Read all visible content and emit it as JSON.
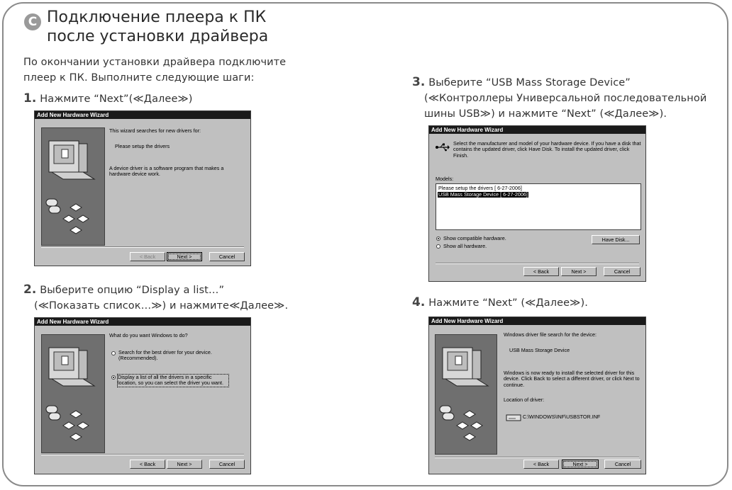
{
  "header": {
    "icon_letter": "C",
    "title_line1": "Подключение плеера к ПК",
    "title_line2": "после установки драйвера"
  },
  "intro": {
    "line1": "По окончании установки драйвера подключите",
    "line2": "плеер к ПК. Выполните следующие шаги:"
  },
  "steps": [
    {
      "number": "1.",
      "line1": "Нажмите “Next”(≪Далее≫)"
    },
    {
      "number": "2.",
      "line1": "Выберите опцию “Display a list…”",
      "line2": "(≪Показать список…≫) и нажмите≪Далее≫."
    },
    {
      "number": "3.",
      "line1": "Выберите “USB Mass Storage Device”",
      "line2": "(≪Контроллеры Универсальной последовательной",
      "line3": "шины USB≫) и нажмите “Next” (≪Далее≫)."
    },
    {
      "number": "4.",
      "line1": "Нажмите “Next” (≪Далее≫)."
    }
  ],
  "dialogs": {
    "d1": {
      "title": "Add New Hardware Wizard",
      "text1": "This wizard searches for new drivers for:",
      "text2": "Please setup the drivers",
      "text3": "A device driver is a software program that makes a hardware device work.",
      "back": "< Back",
      "next": "Next >",
      "cancel": "Cancel"
    },
    "d2": {
      "title": "Add New Hardware Wizard",
      "question": "What do you want Windows to do?",
      "opt1": "Search for the best driver for your device. (Recommended).",
      "opt2": "Display a list of all the drivers in a specific location, so you can select the driver you want.",
      "back": "< Back",
      "next": "Next >",
      "cancel": "Cancel"
    },
    "d3": {
      "title": "Add New Hardware Wizard",
      "desc": "Select the manufacturer and model of your hardware device. If you have a disk that contains the updated driver, click Have Disk. To install the updated driver, click Finish.",
      "models_label": "Models:",
      "models": [
        "Please setup the drivers [ 6-27-2006]",
        "USB Mass Storage Device [ 6-27-2006]"
      ],
      "selected_model": 1,
      "radio1": "Show compatible hardware.",
      "radio2": "Show all hardware.",
      "have_disk": "Have Disk...",
      "back": "< Back",
      "next": "Next >",
      "cancel": "Cancel"
    },
    "d4": {
      "title": "Add New Hardware Wizard",
      "text1": "Windows driver file search for the device:",
      "text2": "USB Mass Storage Device",
      "text3": "Windows is now ready to install the selected driver for this device. Click Back to select a different driver, or click Next to continue.",
      "text4": "Location of driver:",
      "path": "C:\\WINDOWS\\INF\\USBSTOR.INF",
      "back": "< Back",
      "next": "Next >",
      "cancel": "Cancel"
    }
  }
}
